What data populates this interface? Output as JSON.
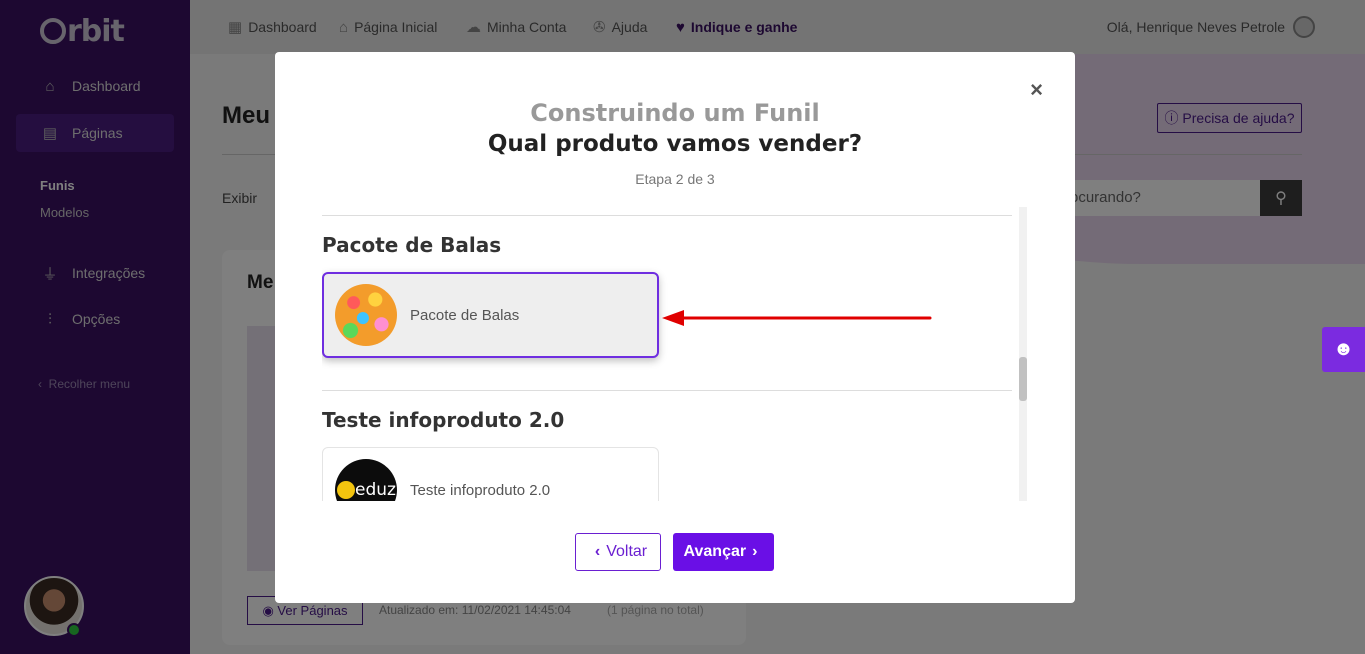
{
  "app": {
    "logo": "rbit"
  },
  "sidebar": {
    "items": [
      {
        "label": "Dashboard",
        "icon": "home-icon"
      },
      {
        "label": "Páginas",
        "icon": "pages-icon"
      },
      {
        "label": "Integrações",
        "icon": "plug-icon"
      },
      {
        "label": "Opções",
        "icon": "sliders-icon"
      }
    ],
    "sub_items": [
      "Funis",
      "Modelos"
    ],
    "collapse_label": "Recolher menu"
  },
  "topbar": {
    "items": [
      {
        "label": "Dashboard",
        "icon": "dashboard-icon"
      },
      {
        "label": "Página Inicial",
        "icon": "store-icon"
      },
      {
        "label": "Minha Conta",
        "icon": "cloud-icon"
      },
      {
        "label": "Ajuda",
        "icon": "lifebuoy-icon"
      },
      {
        "label": "Indique e ganhe",
        "icon": "heart-icon"
      }
    ],
    "greeting": "Olá, Henrique Neves Petrole"
  },
  "background": {
    "page_title": "Meu",
    "help_button": "Precisa de ajuda?",
    "show_label": "Exibir",
    "search_placeholder": "ocurando?",
    "card_title": "Me",
    "view_pages_button": "Ver Páginas",
    "updated_at": "Atualizado em: 11/02/2021 14:45:04",
    "total": "(1 página no total)"
  },
  "modal": {
    "subtitle": "Construindo um Funil",
    "title": "Qual produto vamos vender?",
    "step": "Etapa 2 de 3",
    "close": "×",
    "groups": [
      {
        "title": "Pacote de Balas",
        "product": "Pacote de Balas",
        "selected": true
      },
      {
        "title": "Teste infoproduto 2.0",
        "product": "Teste infoproduto 2.0",
        "thumb_text": "eduzz",
        "selected": false
      }
    ],
    "back_button": "Voltar",
    "next_button": "Avançar"
  },
  "colors": {
    "sidebar": "#3a1063",
    "accent": "#6a0fe6",
    "annotation_arrow": "#e00000"
  }
}
